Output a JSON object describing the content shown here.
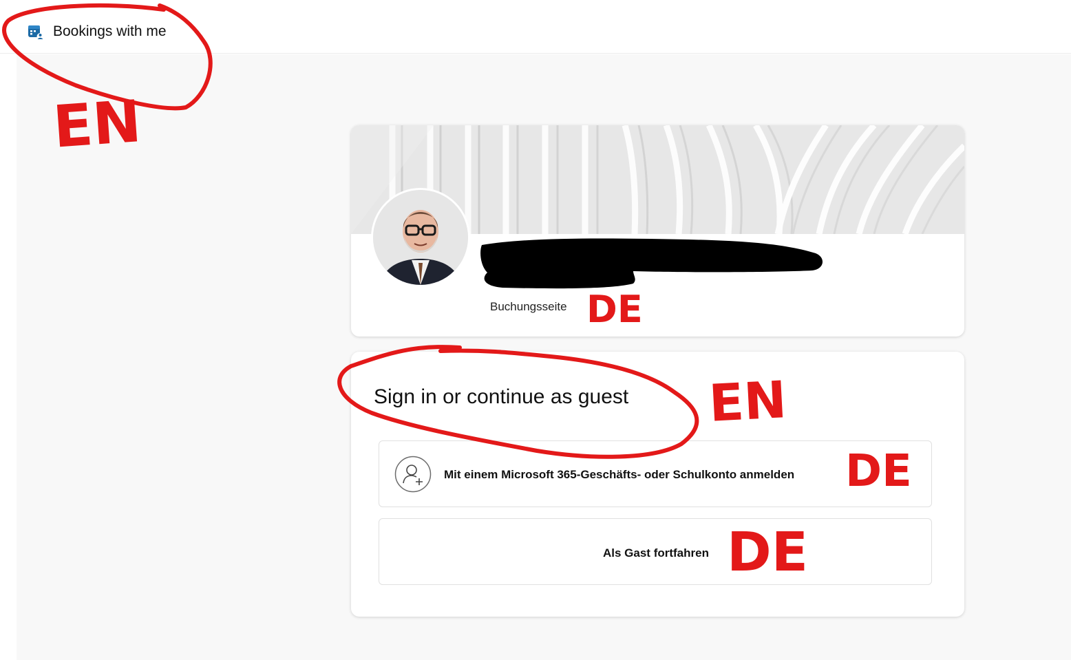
{
  "app": {
    "title": "Bookings with me",
    "icon": "bookings-calendar-icon"
  },
  "profile": {
    "name_redacted": true,
    "subtitle": "Buchungsseite"
  },
  "signin": {
    "heading": "Sign in or continue as guest",
    "options": [
      {
        "label": "Mit einem Microsoft 365-Geschäfts- oder Schulkonto anmelden",
        "icon": "person-add-icon"
      },
      {
        "label": "Als Gast fortfahren"
      }
    ]
  },
  "annotations": {
    "color": "#e31919",
    "labels": [
      "EN",
      "DE",
      "EN",
      "DE",
      "DE"
    ]
  },
  "colors": {
    "accent": "#1c6aa5",
    "background": "#f8f8f8"
  }
}
